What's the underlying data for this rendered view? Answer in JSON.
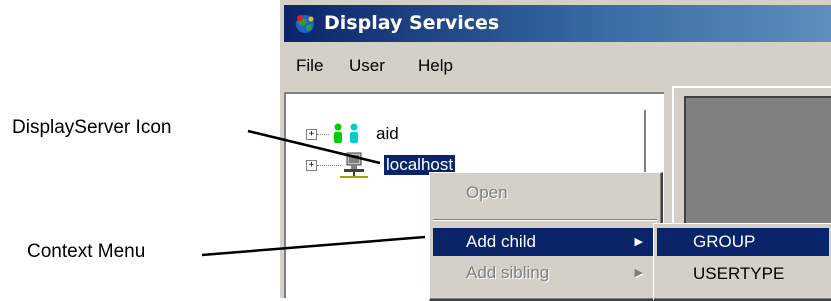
{
  "annotations": {
    "display_server_icon": "DisplayServer Icon",
    "context_menu": "Context Menu"
  },
  "window": {
    "title": "Display Services",
    "menu": [
      "File",
      "User",
      "Help"
    ]
  },
  "tree": {
    "items": [
      {
        "label": "aid",
        "icon": "users-icon",
        "selected": false
      },
      {
        "label": "localhost",
        "icon": "network-computer-icon",
        "selected": true
      }
    ]
  },
  "context_menu": {
    "items": [
      {
        "label": "Open",
        "enabled": false,
        "submenu": false
      },
      {
        "label": "Add child",
        "enabled": true,
        "submenu": true,
        "highlighted": true
      },
      {
        "label": "Add sibling",
        "enabled": false,
        "submenu": true
      }
    ]
  },
  "submenu": {
    "items": [
      {
        "label": "GROUP",
        "highlighted": true
      },
      {
        "label": "USERTYPE",
        "highlighted": false
      }
    ]
  },
  "colors": {
    "titlebar": "#0a246a",
    "selection": "#0a246a",
    "face": "#d4d0c8",
    "user_icon_green": "#00cc00",
    "user_icon_cyan": "#00cccc"
  }
}
